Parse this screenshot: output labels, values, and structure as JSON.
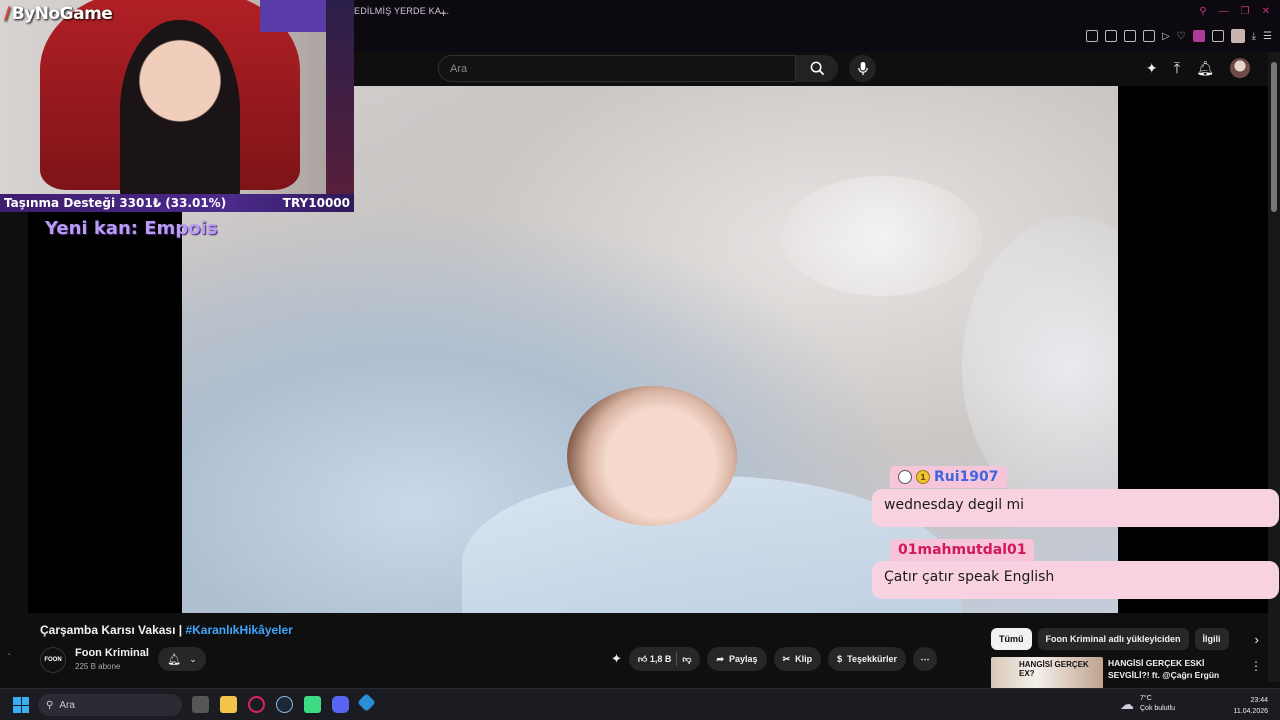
{
  "browser": {
    "tab_title": "EDİLMİŞ YERDE KA...",
    "tab_plus": "+"
  },
  "overlay": {
    "logo": "ByNoGame",
    "donation_left": "Taşınma Desteği 3301₺ (33.01%)",
    "donation_right": "TRY10000",
    "new_sub": "Yeni kan: Empois"
  },
  "youtube": {
    "search_placeholder": "Ara",
    "video_title": "Çarşamba Karısı Vakası | ",
    "video_hashtag": "#KaranlıkHikâyeler",
    "channel_name": "Foon Kriminal",
    "channel_logo_text": "FOON",
    "channel_subs": "225 B abone",
    "likes": "1,8 B",
    "share": "Paylaş",
    "clip": "Klip",
    "thanks": "Teşekkürler",
    "chips": [
      "Tümü",
      "Foon Kriminal adlı yükleyiciden",
      "İlgili"
    ],
    "rec_thumb_text": "HANGİSİ GERÇEK EX?",
    "rec_title": "HANGİSİ GERÇEK ESKİ SEVGİLİ?! ft. @Çağrı Ergün"
  },
  "chat": [
    {
      "user": "Rui1907",
      "user_color": "#3f66e0",
      "message": "wednesday degil mi"
    },
    {
      "user": "01mahmutdal01",
      "user_color": "#d0185c",
      "message": "Çatır çatır speak English"
    }
  ],
  "taskbar": {
    "search_placeholder": "Ara",
    "temperature": "7°C",
    "weather": "Çok bulutlu",
    "time": "23:44",
    "date": "11.04.2026"
  },
  "colors": {
    "accent": "#3ea6ff",
    "chat_bubble": "#f9d2e2",
    "donation_bar": "#4b2a8c"
  }
}
